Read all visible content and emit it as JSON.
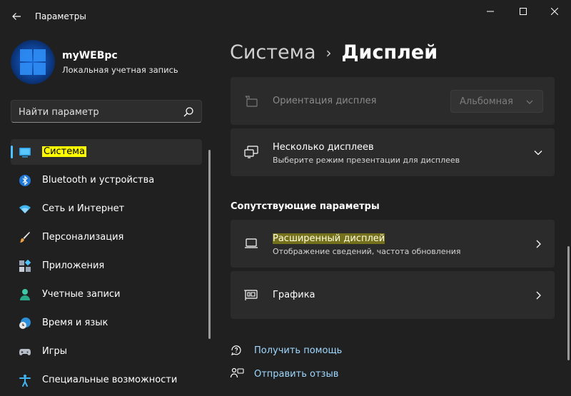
{
  "window": {
    "title": "Параметры"
  },
  "profile": {
    "name": "myWEBpc",
    "account_type": "Локальная учетная запись"
  },
  "search": {
    "placeholder": "Найти параметр"
  },
  "sidebar": {
    "items": [
      {
        "label": "Система",
        "icon": "system-display-icon",
        "active": true
      },
      {
        "label": "Bluetooth и устройства",
        "icon": "bluetooth-icon"
      },
      {
        "label": "Сеть и Интернет",
        "icon": "wifi-icon"
      },
      {
        "label": "Персонализация",
        "icon": "brush-icon"
      },
      {
        "label": "Приложения",
        "icon": "apps-icon"
      },
      {
        "label": "Учетные записи",
        "icon": "person-icon"
      },
      {
        "label": "Время и язык",
        "icon": "globe-clock-icon"
      },
      {
        "label": "Игры",
        "icon": "gamepad-icon"
      },
      {
        "label": "Специальные возможности",
        "icon": "accessibility-icon"
      }
    ]
  },
  "breadcrumb": {
    "parent": "Система",
    "separator": "›",
    "current": "Дисплей"
  },
  "cards": {
    "orientation": {
      "title": "Ориентация дисплея",
      "value": "Альбомная",
      "disabled": true
    },
    "multiple": {
      "title": "Несколько дисплеев",
      "subtitle": "Выберите режим презентации для дисплеев"
    }
  },
  "related": {
    "heading": "Сопутствующие параметры",
    "advanced": {
      "title": "Расширенный дисплей",
      "subtitle": "Отображение сведений, частота обновления"
    },
    "graphics": {
      "title": "Графика"
    }
  },
  "links": {
    "help": "Получить помощь",
    "feedback": "Отправить отзыв"
  },
  "colors": {
    "background": "#202020",
    "card": "#2b2b2b",
    "accent": "#4cc2ff",
    "link": "#9fd8ff",
    "highlight": "#fffb00"
  }
}
